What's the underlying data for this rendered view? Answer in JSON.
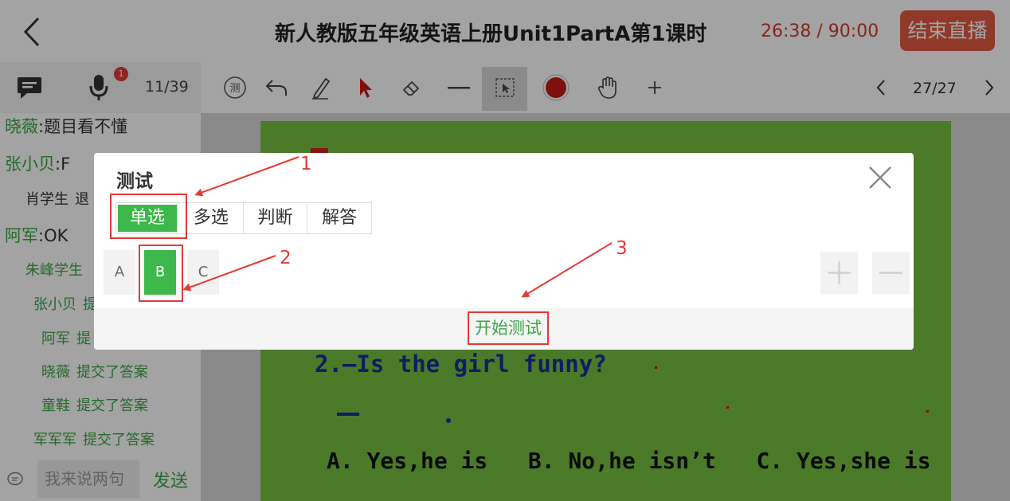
{
  "header": {
    "title": "新人教版五年级英语上册Unit1PartA第1课时",
    "timer": "26:38 / 90:00",
    "end_button": "结束直播"
  },
  "toolbar": {
    "mic_badge": "1",
    "slide_count": "11/39",
    "quiz_icon_label": "测",
    "page_count": "27/27"
  },
  "chat": {
    "messages": [
      {
        "name": "晓薇",
        "text": ":题目看不懂"
      },
      {
        "name": "张小贝",
        "text": ":F"
      },
      {
        "name": "肖学生",
        "text": "退"
      },
      {
        "name": "阿军",
        "text": ":OK"
      },
      {
        "name": "朱峰学生",
        "text": ""
      },
      {
        "name": "张小贝",
        "text": "提"
      },
      {
        "name": "阿军",
        "text": "提"
      },
      {
        "name": "晓薇",
        "text": "提交了答案"
      },
      {
        "name": "童鞋",
        "text": "提交了答案"
      },
      {
        "name": "军军军",
        "text": "提交了答案"
      }
    ],
    "input_placeholder": "我来说两句",
    "send_label": "发送"
  },
  "slide": {
    "question": "2.—Is the girl funny?",
    "answer_blank": "—",
    "options": "A. Yes,he is   B. No,he isn’t   C. Yes,she is"
  },
  "dialog": {
    "title": "测试",
    "tabs": [
      "单选",
      "多选",
      "判断",
      "解答"
    ],
    "active_tab": "单选",
    "options": [
      "A",
      "B",
      "C"
    ],
    "selected_option": "B",
    "start_button": "开始测试"
  },
  "annotations": [
    "1",
    "2",
    "3"
  ],
  "colors": {
    "accent_green": "#3db84a",
    "timer_red": "#d23b2e",
    "end_button": "#e25a44",
    "annotation_red": "#e53935",
    "slide_green": "#76bf41",
    "question_blue": "#1b2d99"
  }
}
